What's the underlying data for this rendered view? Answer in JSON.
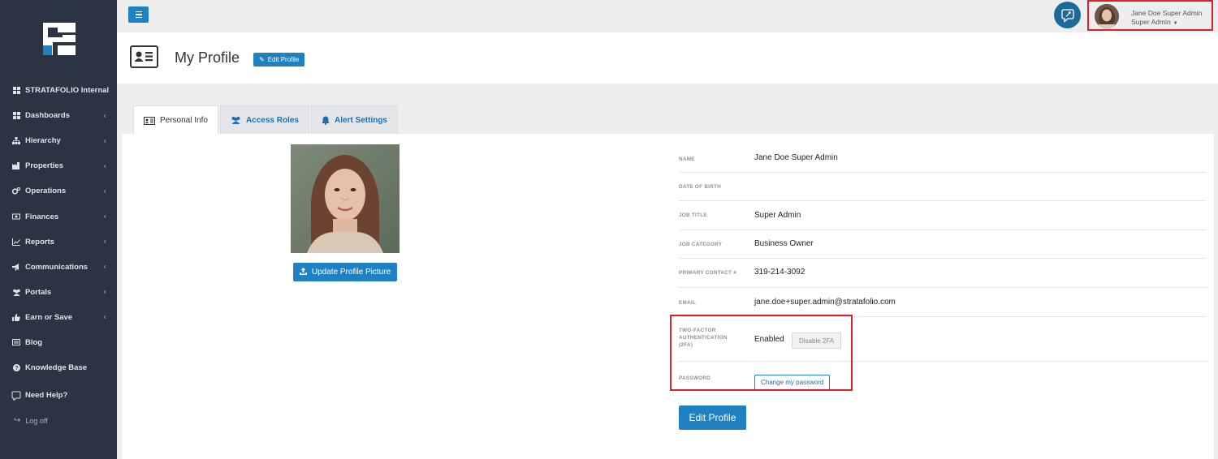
{
  "app": {
    "brand_color": "#1f80c2",
    "sidebar_color": "#2b3443",
    "highlight_color": "#d8232a"
  },
  "sidebar": {
    "items": [
      {
        "label": "STRATAFOLIO Internal",
        "icon": "grid-icon",
        "has_chevron": true
      },
      {
        "label": "Dashboards",
        "icon": "grid-icon",
        "has_chevron": true
      },
      {
        "label": "Hierarchy",
        "icon": "sitemap-icon",
        "has_chevron": true
      },
      {
        "label": "Properties",
        "icon": "building-icon",
        "has_chevron": true
      },
      {
        "label": "Operations",
        "icon": "gears-icon",
        "has_chevron": true
      },
      {
        "label": "Finances",
        "icon": "money-icon",
        "has_chevron": true
      },
      {
        "label": "Reports",
        "icon": "line-chart-icon",
        "has_chevron": true
      },
      {
        "label": "Communications",
        "icon": "bullhorn-icon",
        "has_chevron": true
      },
      {
        "label": "Portals",
        "icon": "users-icon",
        "has_chevron": true
      },
      {
        "label": "Earn or Save",
        "icon": "thumbs-up-icon",
        "has_chevron": true
      },
      {
        "label": "Blog",
        "icon": "newspaper-icon",
        "has_chevron": false
      },
      {
        "label": "Knowledge Base",
        "icon": "question-circle-icon",
        "has_chevron": false
      }
    ],
    "help_label": "Need Help?",
    "logoff_label": "Log off"
  },
  "topbar": {
    "user_name": "Jane Doe Super Admin",
    "user_role": "Super Admin"
  },
  "header": {
    "title": "My Profile",
    "edit_label": "Edit Profile"
  },
  "tabs": [
    {
      "label": "Personal Info",
      "icon": "id-card-icon",
      "active": true
    },
    {
      "label": "Access Roles",
      "icon": "users-icon",
      "active": false
    },
    {
      "label": "Alert Settings",
      "icon": "bell-icon",
      "active": false
    }
  ],
  "profile": {
    "update_picture_label": "Update Profile Picture",
    "fields": {
      "name_label": "NAME",
      "name_value": "Jane Doe Super Admin",
      "dob_label": "DATE OF BIRTH",
      "dob_value": "",
      "job_title_label": "JOB TITLE",
      "job_title_value": "Super Admin",
      "job_category_label": "JOB CATEGORY",
      "job_category_value": "Business Owner",
      "phone_label": "PRIMARY CONTACT #",
      "phone_value": "319-214-3092",
      "email_label": "EMAIL",
      "email_value": "jane.doe+super.admin@stratafolio.com",
      "tfa_label_1": "TWO-FACTOR",
      "tfa_label_2": "AUTHENTICATION",
      "tfa_label_3": "(2FA)",
      "tfa_value": "Enabled",
      "tfa_button": "Disable 2FA",
      "password_label": "PASSWORD",
      "password_button": "Change my password"
    },
    "edit_button": "Edit Profile"
  }
}
